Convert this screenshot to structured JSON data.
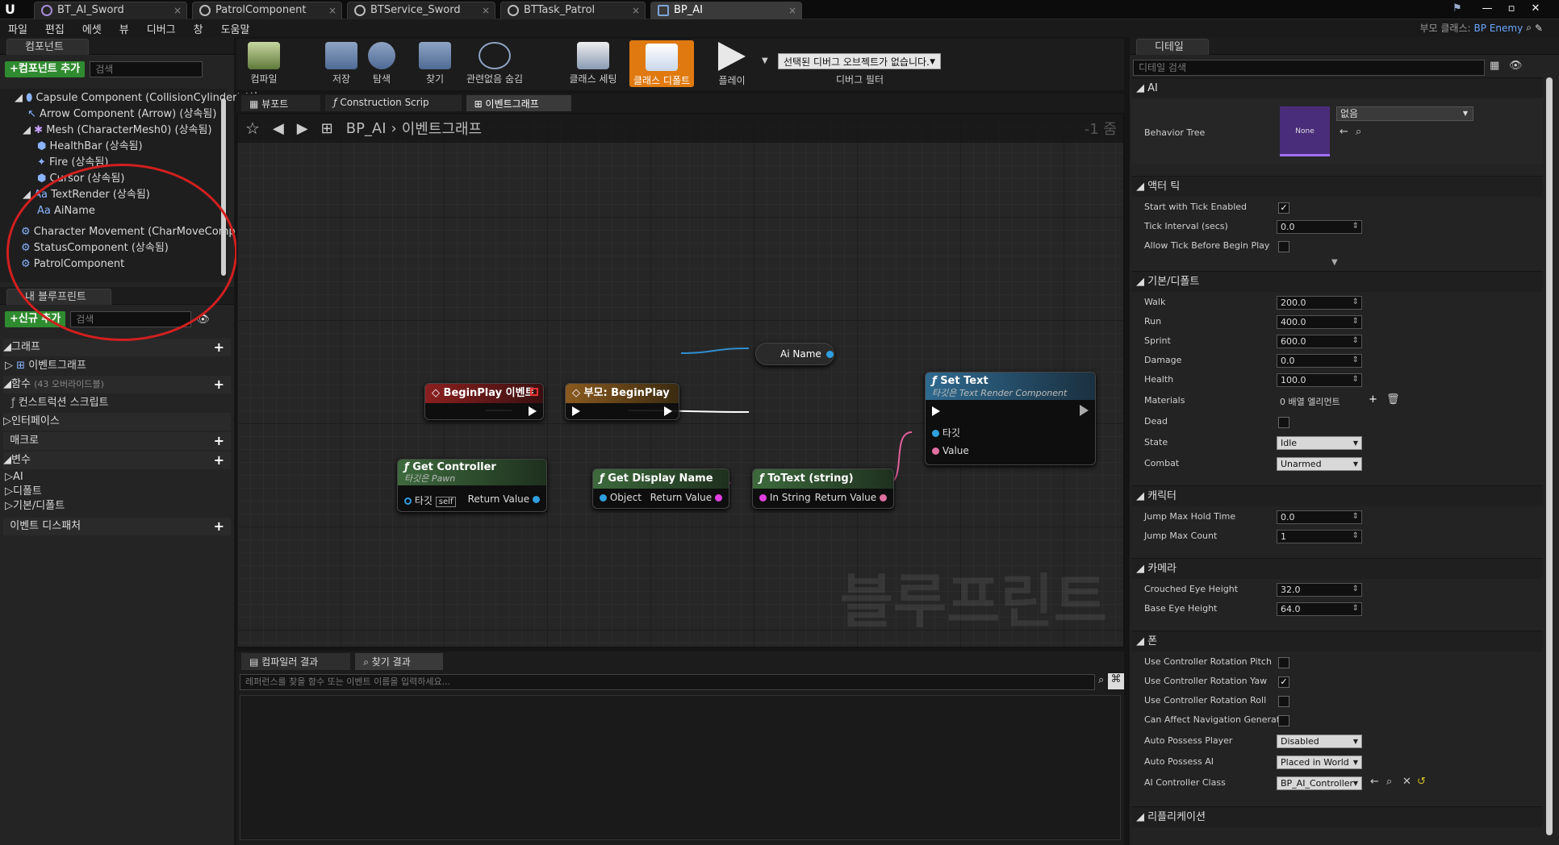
{
  "tabs": [
    "BT_AI_Sword",
    "PatrolComponent",
    "BTService_Sword",
    "BTTask_Patrol",
    "BP_AI"
  ],
  "menu": [
    "파일",
    "편집",
    "에셋",
    "뷰",
    "디버그",
    "창",
    "도움말"
  ],
  "parent_class_label": "부모 클래스:",
  "parent_class_value": "BP Enemy",
  "components": {
    "title": "컴포넌트",
    "add_button": "+컴포넌트 추가",
    "search_placeholder": "검색",
    "items": [
      "Capsule Component (CollisionCylinder) (상",
      "Arrow Component (Arrow) (상속됨)",
      "Mesh (CharacterMesh0) (상속됨)",
      "HealthBar (상속됨)",
      "Fire (상속됨)",
      "Cursor (상속됨)",
      "TextRender (상속됨)",
      "AiName",
      "Character Movement (CharMoveComp) (상",
      "StatusComponent (상속됨)",
      "PatrolComponent"
    ]
  },
  "my_blueprint": {
    "title": "내 블루프린트",
    "new_button": "+신규 추가",
    "search_placeholder": "검색",
    "graph_label": "그래프",
    "event_graph": "이벤트그래프",
    "functions_label": "함수",
    "functions_count": "(43 오버라이드블)",
    "construction_script": "컨스트럭션 스크립트",
    "interfaces": "인터페이스",
    "macros": "매크로",
    "variables": "변수",
    "var_groups": [
      "AI",
      "디폴트",
      "기본/디폴트"
    ],
    "event_dispatchers": "이벤트 디스패처"
  },
  "toolbar": {
    "compile": "컴파일",
    "save": "저장",
    "browse": "탐색",
    "find": "찾기",
    "hide_unrelated": "관련없음 숨김",
    "class_settings": "클래스 세팅",
    "class_defaults": "클래스 디폴트",
    "play": "플레이",
    "debug_select": "선택된 디버그 오브젝트가 없습니다.",
    "debug_filter": "디버그 필터"
  },
  "graph_tabs": [
    "뷰포트",
    "Construction Scrip",
    "이벤트그래프"
  ],
  "breadcrumb": {
    "bp": "BP_AI",
    "graph": "이벤트그래프",
    "zoom": "-1 줌"
  },
  "watermark": "블루프린트",
  "nodes": {
    "beginplay": "BeginPlay 이벤트",
    "parent_beginplay": "부모: BeginPlay",
    "settext": "Set Text",
    "settext_sub": "타깃은 Text Render Component",
    "target": "타깃",
    "value": "Value",
    "ainame": "Ai Name",
    "getcontroller": "Get Controller",
    "getcontroller_sub": "타깃은 Pawn",
    "self": "self",
    "return_value": "Return Value",
    "getdisplayname": "Get Display Name",
    "object": "Object",
    "totext": "ToText (string)",
    "instring": "In String"
  },
  "bottom": {
    "tab1": "컴파일러 결과",
    "tab2": "찾기 결과",
    "search_placeholder": "레퍼런스를 찾을 함수 또는 이벤트 이름을 입력하세요..."
  },
  "details": {
    "title": "디테일",
    "search_placeholder": "디테일 검색",
    "sections": {
      "ai": "AI",
      "tick": "액터 틱",
      "defaults": "기본/디폴트",
      "character": "캐릭터",
      "camera": "카메라",
      "pawn": "폰",
      "replication": "리플리케이션"
    },
    "behavior_tree_label": "Behavior Tree",
    "behavior_tree_thumb": "None",
    "behavior_tree_value": "없음",
    "tick": {
      "start": "Start with Tick Enabled",
      "interval": "Tick Interval (secs)",
      "interval_val": "0.0",
      "allow": "Allow Tick Before Begin Play"
    },
    "walk": "Walk",
    "walk_val": "200.0",
    "run": "Run",
    "run_val": "400.0",
    "sprint": "Sprint",
    "sprint_val": "600.0",
    "damage": "Damage",
    "damage_val": "0.0",
    "health": "Health",
    "health_val": "100.0",
    "materials": "Materials",
    "materials_val": "0 배열 엘리먼트",
    "dead": "Dead",
    "state": "State",
    "state_val": "Idle",
    "combat": "Combat",
    "combat_val": "Unarmed",
    "jump_hold": "Jump Max Hold Time",
    "jump_hold_val": "0.0",
    "jump_count": "Jump Max Count",
    "jump_count_val": "1",
    "crouch": "Crouched Eye Height",
    "crouch_val": "32.0",
    "base_eye": "Base Eye Height",
    "base_eye_val": "64.0",
    "ucr_pitch": "Use Controller Rotation Pitch",
    "ucr_yaw": "Use Controller Rotation Yaw",
    "ucr_roll": "Use Controller Rotation Roll",
    "can_nav": "Can Affect Navigation Generatic",
    "auto_player": "Auto Possess Player",
    "auto_player_val": "Disabled",
    "auto_ai": "Auto Possess AI",
    "auto_ai_val": "Placed in World",
    "ai_ctrl": "AI Controller Class",
    "ai_ctrl_val": "BP_AI_Controller"
  },
  "colors": {
    "accent": "#e07a10",
    "highlight": "#d21f1f",
    "event_header": "#8a1f1f",
    "function_header": "#2f6a8f",
    "pure_header": "#3d6a3d"
  }
}
